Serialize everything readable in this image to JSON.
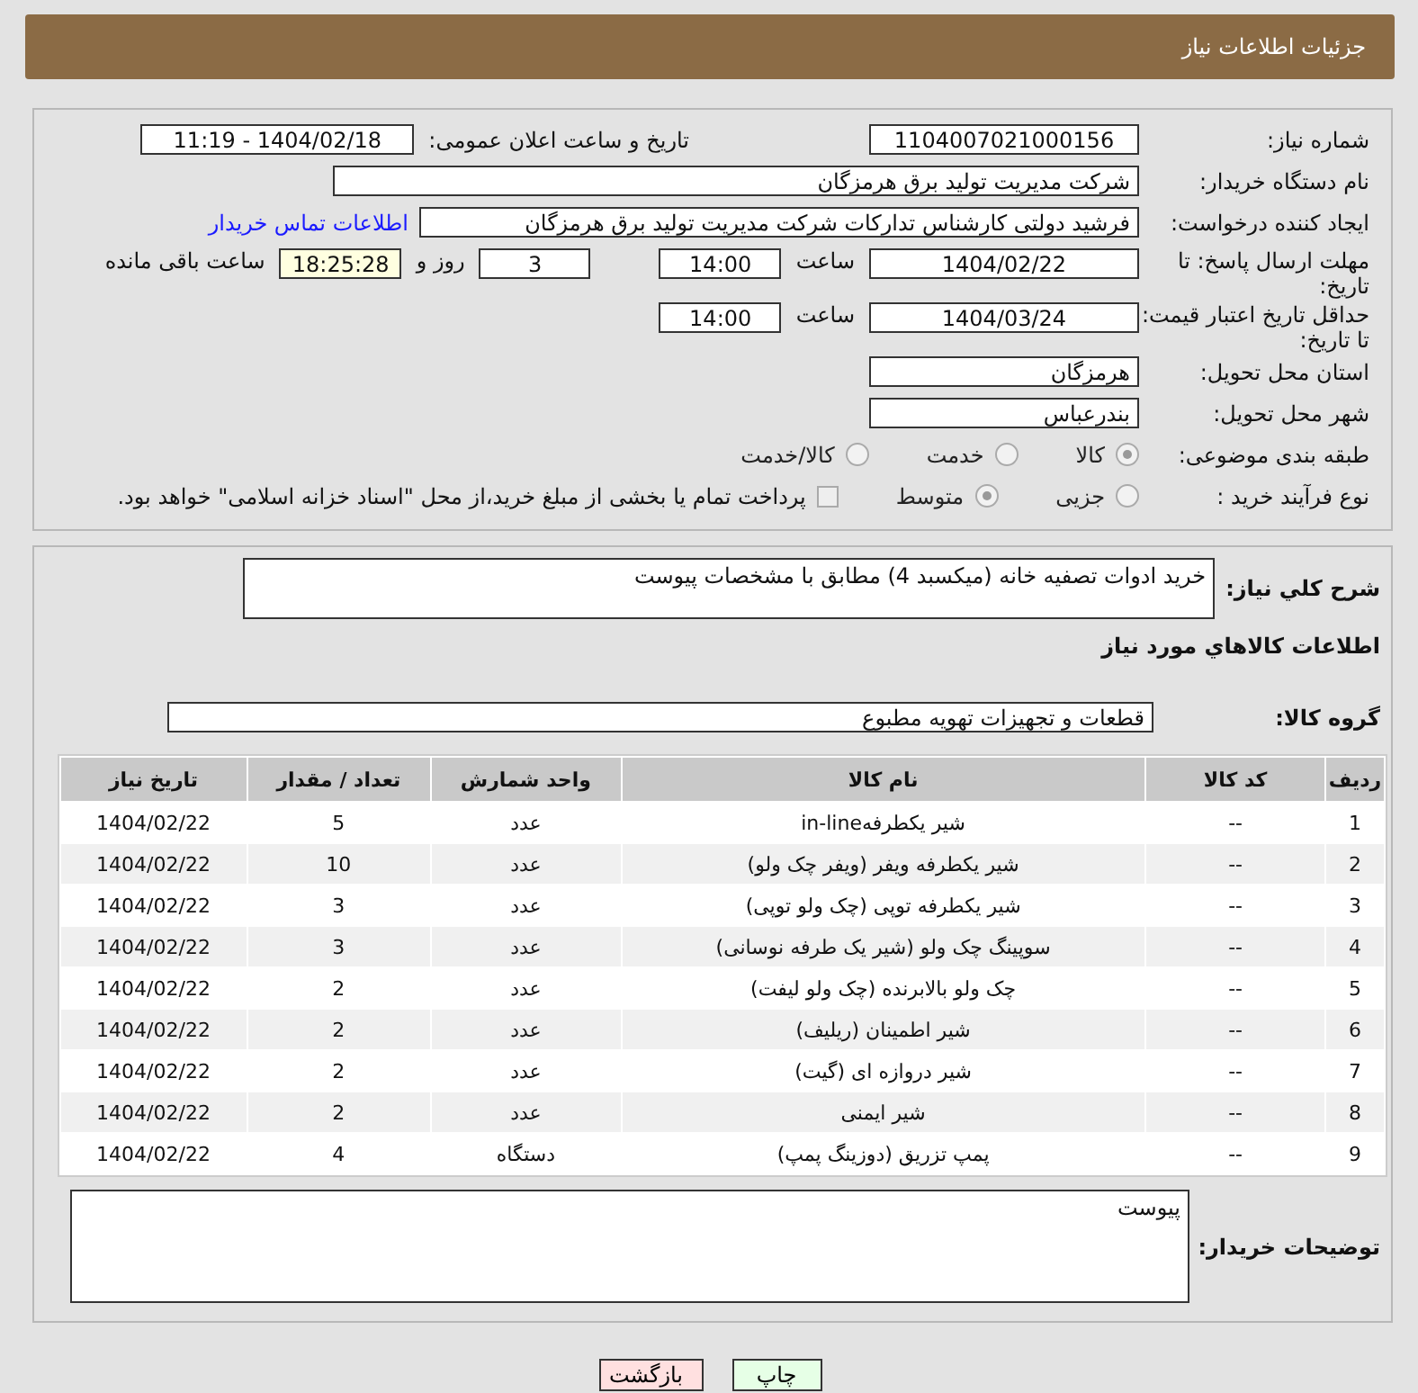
{
  "header": {
    "title": "جزئیات اطلاعات نیاز"
  },
  "need_number": {
    "label": "شماره نیاز:",
    "value": "1104007021000156"
  },
  "announce": {
    "label": "تاریخ و ساعت اعلان عمومی:",
    "value": "1404/02/18 - 11:19"
  },
  "buyer_org": {
    "label": "نام دستگاه خریدار:",
    "value": "شرکت مدیریت تولید برق هرمزگان"
  },
  "creator": {
    "label": "ایجاد کننده درخواست:",
    "value": "فرشید دولتی کارشناس تدارکات شرکت مدیریت تولید برق هرمزگان",
    "link": "اطلاعات تماس خریدار"
  },
  "deadline": {
    "label": "مهلت ارسال پاسخ: تا تاریخ:",
    "date": "1404/02/22",
    "time_label": "ساعت",
    "time": "14:00",
    "days": "3",
    "days_label": "روز و",
    "remaining": "18:25:28",
    "remaining_label": "ساعت باقی مانده"
  },
  "validity": {
    "label": "حداقل تاریخ اعتبار قیمت: تا تاریخ:",
    "date": "1404/03/24",
    "time_label": "ساعت",
    "time": "14:00"
  },
  "province": {
    "label": "استان محل تحویل:",
    "value": "هرمزگان"
  },
  "city": {
    "label": "شهر محل تحویل:",
    "value": "بندرعباس"
  },
  "category": {
    "label": "طبقه بندی موضوعی:",
    "options": [
      {
        "label": "کالا",
        "selected": true
      },
      {
        "label": "خدمت",
        "selected": false
      },
      {
        "label": "کالا/خدمت",
        "selected": false
      }
    ]
  },
  "process": {
    "label": "نوع فرآیند خرید :",
    "options": [
      {
        "label": "جزیی",
        "selected": false
      },
      {
        "label": "متوسط",
        "selected": true
      }
    ],
    "payment": {
      "checked": false,
      "text": "پرداخت تمام یا بخشی از مبلغ خرید،از محل \"اسناد خزانه اسلامی\" خواهد بود."
    }
  },
  "description": {
    "label": "شرح کلي نياز:",
    "value": "خرید ادوات تصفیه خانه (میکسبد 4) مطابق با مشخصات پیوست"
  },
  "goods_title": "اطلاعات كالاهاي مورد نياز",
  "goods_group": {
    "label": "گروه کالا:",
    "value": "قطعات و تجهیزات تهویه مطبوع"
  },
  "table": {
    "columns": [
      "ردیف",
      "کد کالا",
      "نام کالا",
      "واحد شمارش",
      "تعداد / مقدار",
      "تاریخ نیاز"
    ],
    "rows": [
      [
        "1",
        "--",
        "شیر یکطرفهin-line",
        "عدد",
        "5",
        "1404/02/22"
      ],
      [
        "2",
        "--",
        "شیر یکطرفه ویفر (ویفر چک ولو)",
        "عدد",
        "10",
        "1404/02/22"
      ],
      [
        "3",
        "--",
        "شیر یکطرفه توپی (چک ولو توپی)",
        "عدد",
        "3",
        "1404/02/22"
      ],
      [
        "4",
        "--",
        "سوپینگ چک ولو (شیر یک طرفه نوسانی)",
        "عدد",
        "3",
        "1404/02/22"
      ],
      [
        "5",
        "--",
        "چک ولو بالابرنده (چک ولو لیفت)",
        "عدد",
        "2",
        "1404/02/22"
      ],
      [
        "6",
        "--",
        "شیر اطمینان (ریلیف)",
        "عدد",
        "2",
        "1404/02/22"
      ],
      [
        "7",
        "--",
        "شیر دروازه ای (گیت)",
        "عدد",
        "2",
        "1404/02/22"
      ],
      [
        "8",
        "--",
        "شیر ایمنی",
        "عدد",
        "2",
        "1404/02/22"
      ],
      [
        "9",
        "--",
        "پمپ تزریق (دوزینگ پمپ)",
        "دستگاه",
        "4",
        "1404/02/22"
      ]
    ]
  },
  "buyer_notes": {
    "label": "توضیحات خریدار:",
    "value": "پیوست"
  },
  "buttons": [
    {
      "label": "چاپ",
      "kind": "print"
    },
    {
      "label": "بازگشت",
      "kind": "back"
    }
  ]
}
